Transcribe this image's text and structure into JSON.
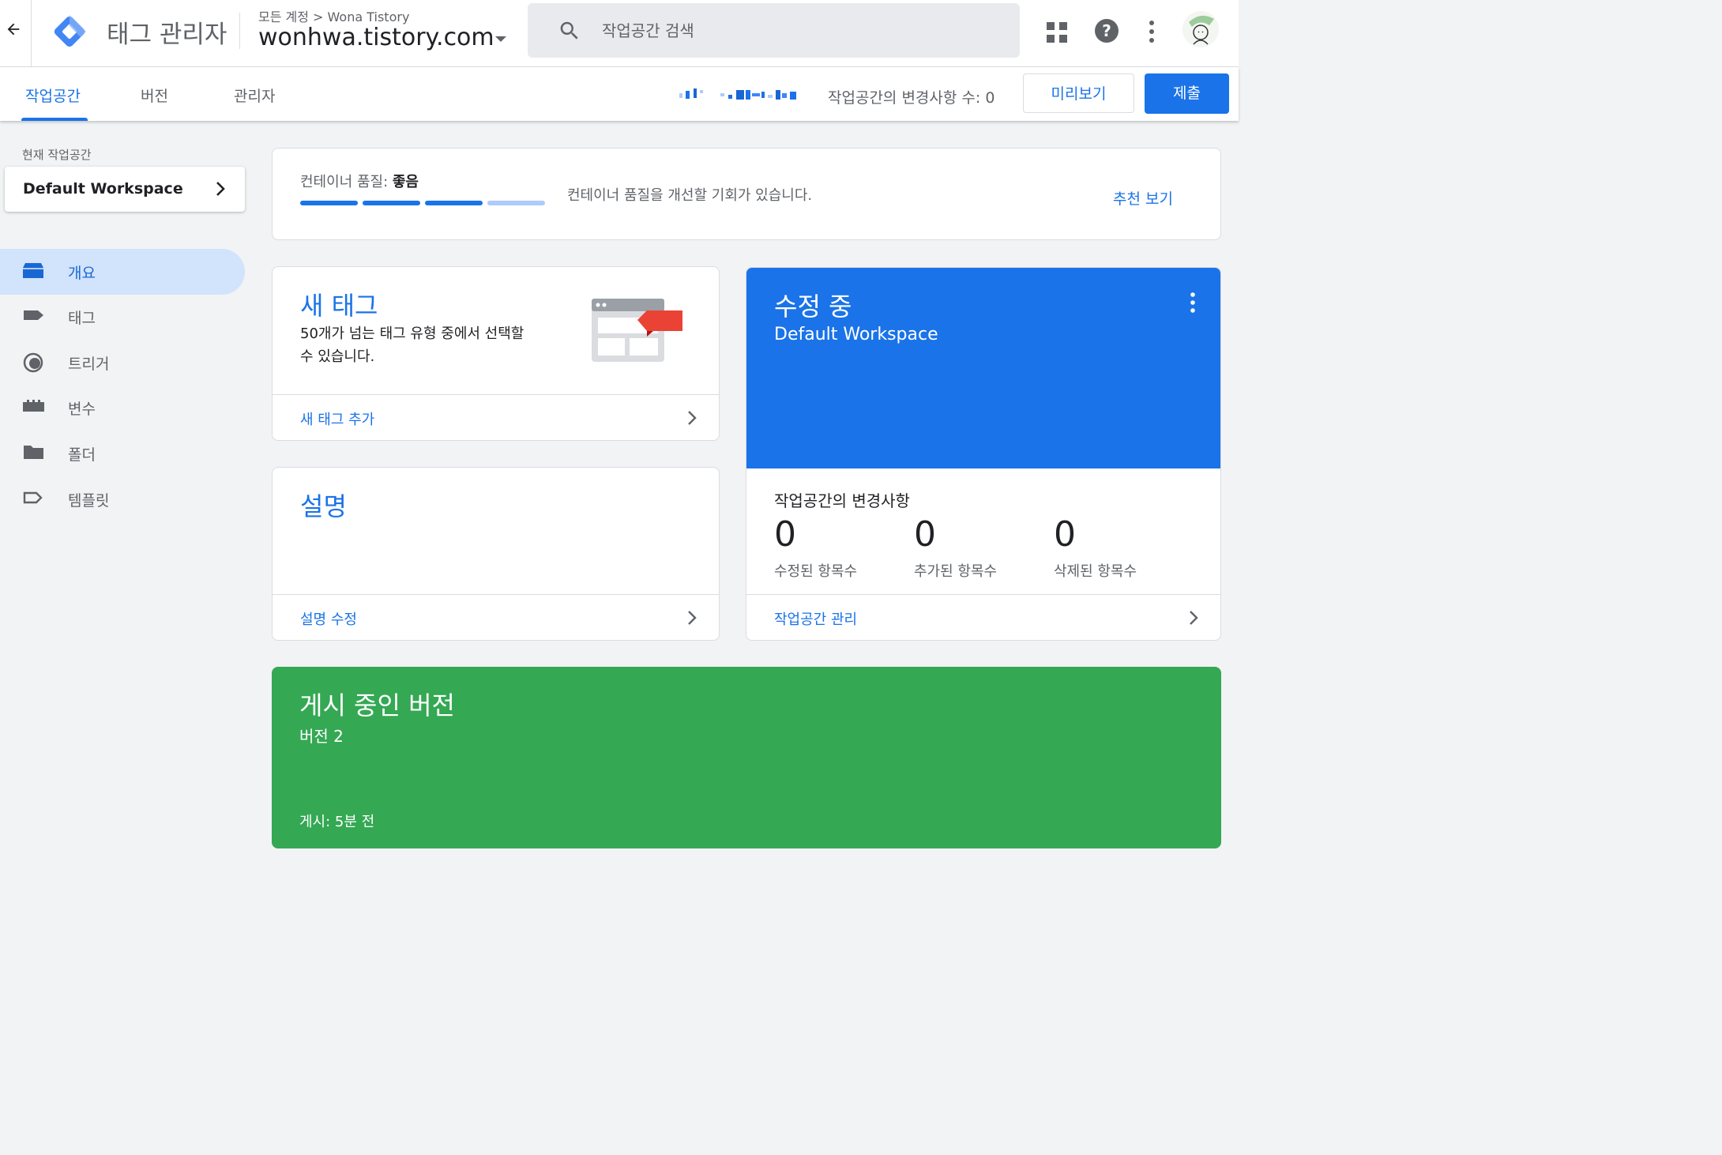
{
  "header": {
    "app_name": "태그 관리자",
    "breadcrumb": "모든 계정 > Wona Tistory",
    "account": "wonhwa.tistory.com",
    "search_placeholder": "작업공간 검색"
  },
  "tabs": {
    "workspace": "작업공간",
    "versions": "버전",
    "admin": "관리자"
  },
  "toolbar": {
    "changes_count": "작업공간의 변경사항 수: 0",
    "preview_label": "미리보기",
    "submit_label": "제출"
  },
  "sidebar": {
    "current_workspace_label": "현재 작업공간",
    "workspace_name": "Default Workspace",
    "nav": {
      "overview": "개요",
      "tags": "태그",
      "triggers": "트리거",
      "variables": "변수",
      "folders": "폴더",
      "templates": "템플릿"
    }
  },
  "quality": {
    "label": "컨테이너 품질: ",
    "value": "좋음",
    "level_segments_filled": 3,
    "level_segments_total": 4,
    "message": "컨테이너 품질을 개선할 기회가 있습니다.",
    "link": "추천 보기"
  },
  "new_tag": {
    "title": "새 태그",
    "description": "50개가 넘는 태그 유형 중에서 선택할 수 있습니다.",
    "footer": "새 태그 추가"
  },
  "description_card": {
    "title": "설명",
    "footer": "설명 수정"
  },
  "editing": {
    "title": "수정 중",
    "workspace": "Default Workspace",
    "changes_title": "작업공간의 변경사항",
    "stats": {
      "modified": {
        "value": "0",
        "label": "수정된 항목수"
      },
      "added": {
        "value": "0",
        "label": "추가된 항목수"
      },
      "deleted": {
        "value": "0",
        "label": "삭제된 항목수"
      }
    },
    "footer": "작업공간 관리"
  },
  "live_version": {
    "title": "게시 중인 버전",
    "version": "버전 2",
    "published": "게시: 5분 전"
  },
  "colors": {
    "primary": "#1a73e8",
    "quality_filled": "#1a73e8",
    "quality_empty": "#aecbfa",
    "live_green": "#34a853",
    "tag_red": "#ea4335"
  }
}
